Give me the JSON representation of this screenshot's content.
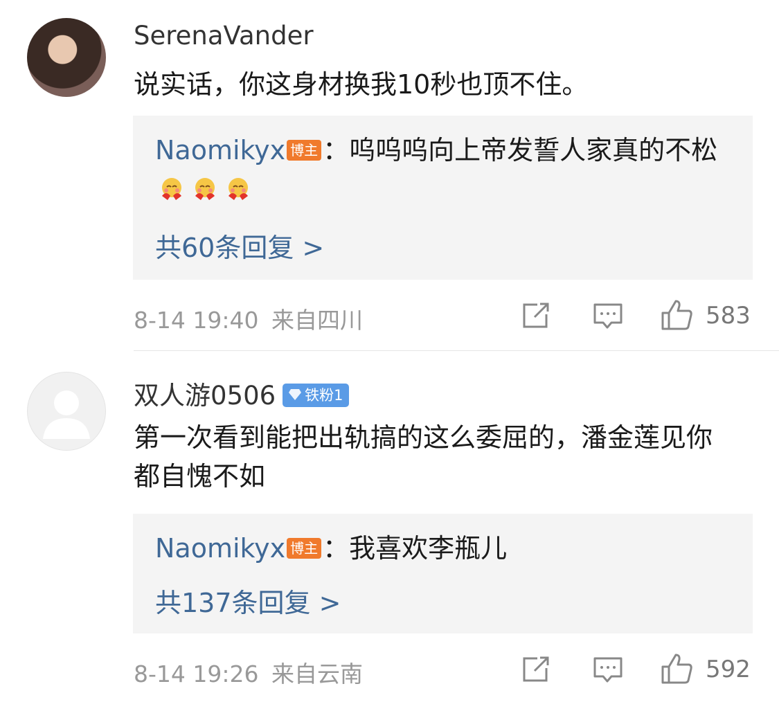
{
  "comments": [
    {
      "username": "SerenaVander",
      "text": "说实话，你这身材换我10秒也顶不住。",
      "reply": {
        "name": "Naomikyx",
        "owner_badge": "博主",
        "text": "：呜呜呜向上帝发誓人家真的不松",
        "emoji_icon": "hug-emoji-icon"
      },
      "reply_count": "共60条回复 >",
      "date": "8-14 19:40",
      "location": "来自四川",
      "likes": "583"
    },
    {
      "username": "双人游0506",
      "fan_badge": "铁粉1",
      "text": "第一次看到能把出轨搞的这么委屈的，潘金莲见你都自愧不如",
      "reply": {
        "name": "Naomikyx",
        "owner_badge": "博主",
        "text": "：我喜欢李瓶儿"
      },
      "reply_count": "共137条回复 >",
      "date": "8-14 19:26",
      "location": "来自云南",
      "likes": "592"
    }
  ],
  "colors": {
    "link": "#3f6896",
    "owner_badge": "#f07a2c",
    "fan_badge": "#5a9be6"
  }
}
